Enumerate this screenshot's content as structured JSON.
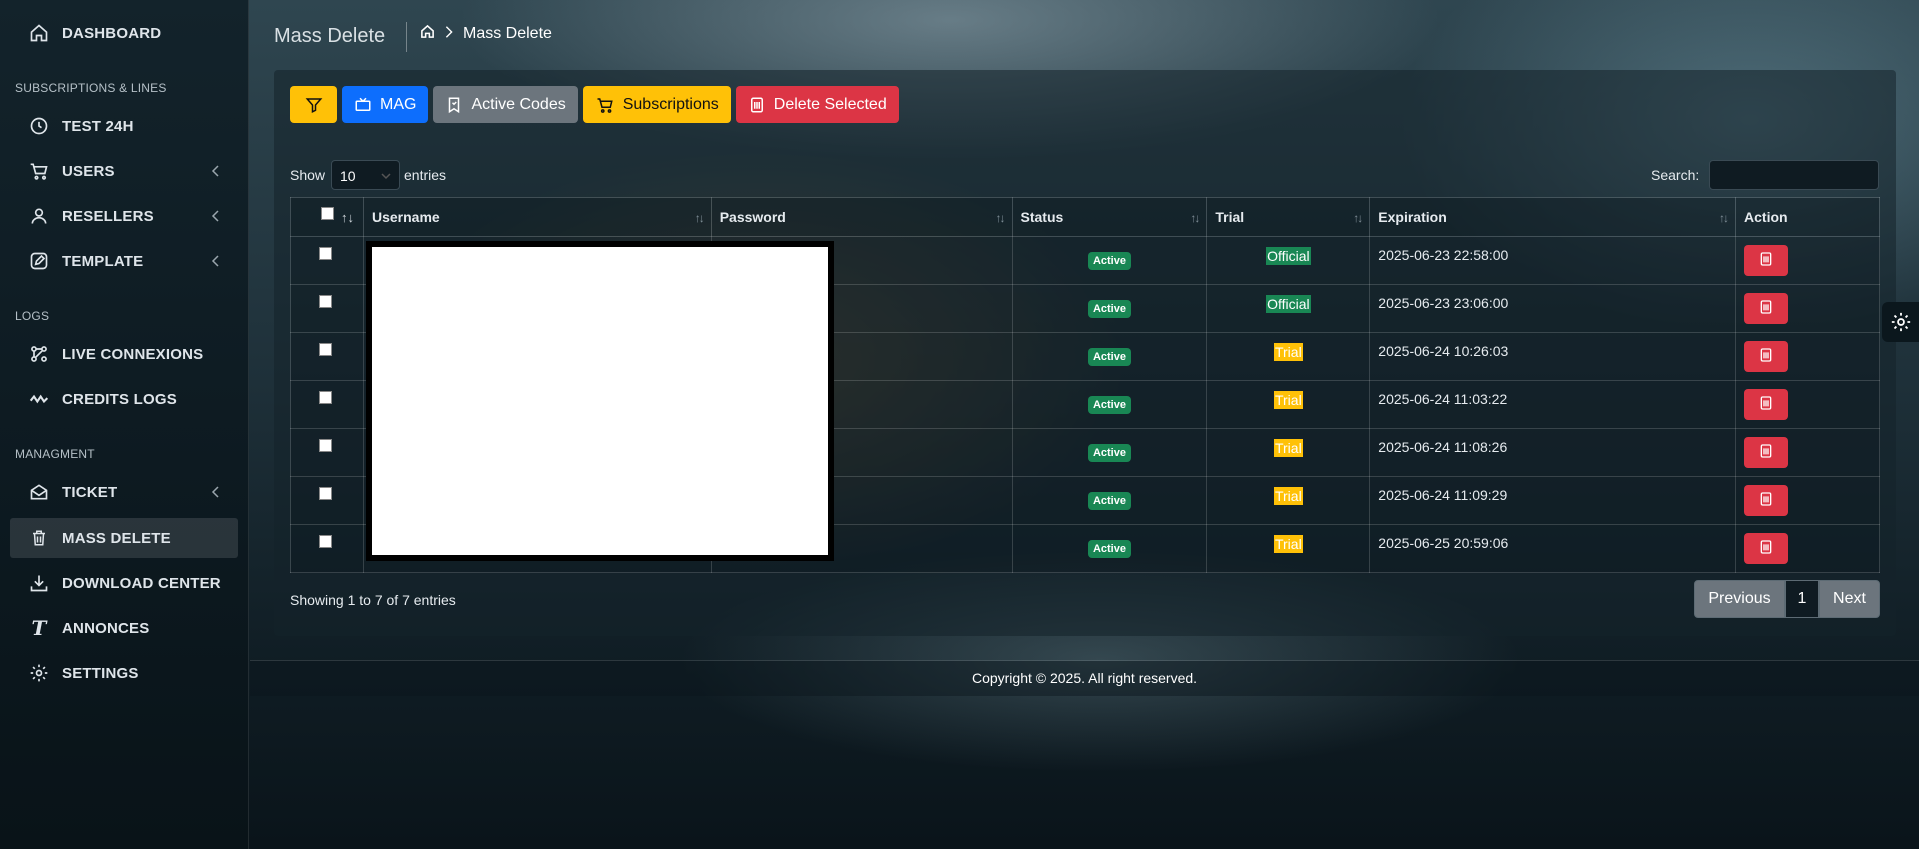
{
  "sidebar": {
    "dashboard": "DASHBOARD",
    "section_subs": "SUBSCRIPTIONS & LINES",
    "test24h": "TEST 24H",
    "users": "USERS",
    "resellers": "RESELLERS",
    "template": "TEMPLATE",
    "section_logs": "LOGS",
    "live": "LIVE CONNEXIONS",
    "credits": "CREDITS LOGS",
    "section_manage": "MANAGMENT",
    "ticket": "TICKET",
    "massdelete": "MASS DELETE",
    "download": "DOWNLOAD CENTER",
    "annonces": "ANNONCES",
    "settings": "SETTINGS"
  },
  "header": {
    "title": "Mass Delete",
    "breadcrumb": "Mass Delete"
  },
  "toolbar": {
    "mag": "MAG",
    "active_codes": "Active Codes",
    "subscriptions": "Subscriptions",
    "delete_selected": "Delete Selected"
  },
  "table_controls": {
    "show": "Show",
    "page_size": "10",
    "entries": "entries",
    "search_label": "Search:",
    "search_value": ""
  },
  "table": {
    "headers": {
      "username": "Username",
      "password": "Password",
      "status": "Status",
      "trial": "Trial",
      "expiration": "Expiration",
      "action": "Action"
    },
    "rows": [
      {
        "status": "Active",
        "trial": "Official",
        "expiration": "2025-06-23 22:58:00"
      },
      {
        "status": "Active",
        "trial": "Official",
        "expiration": "2025-06-23 23:06:00"
      },
      {
        "status": "Active",
        "trial": "Trial",
        "expiration": "2025-06-24 10:26:03"
      },
      {
        "status": "Active",
        "trial": "Trial",
        "expiration": "2025-06-24 11:03:22"
      },
      {
        "status": "Active",
        "trial": "Trial",
        "expiration": "2025-06-24 11:08:26"
      },
      {
        "status": "Active",
        "trial": "Trial",
        "expiration": "2025-06-24 11:09:29"
      },
      {
        "status": "Active",
        "trial": "Trial",
        "expiration": "2025-06-25 20:59:06"
      }
    ]
  },
  "info": "Showing 1 to 7 of 7 entries",
  "pagination": {
    "previous": "Previous",
    "current": "1",
    "next": "Next"
  },
  "footer": "Copyright © 2025. All right reserved.",
  "colors": {
    "primary": "#0d6efd",
    "warning": "#ffc107",
    "danger": "#dc3545",
    "secondary": "#6c757d",
    "success": "#198754"
  }
}
